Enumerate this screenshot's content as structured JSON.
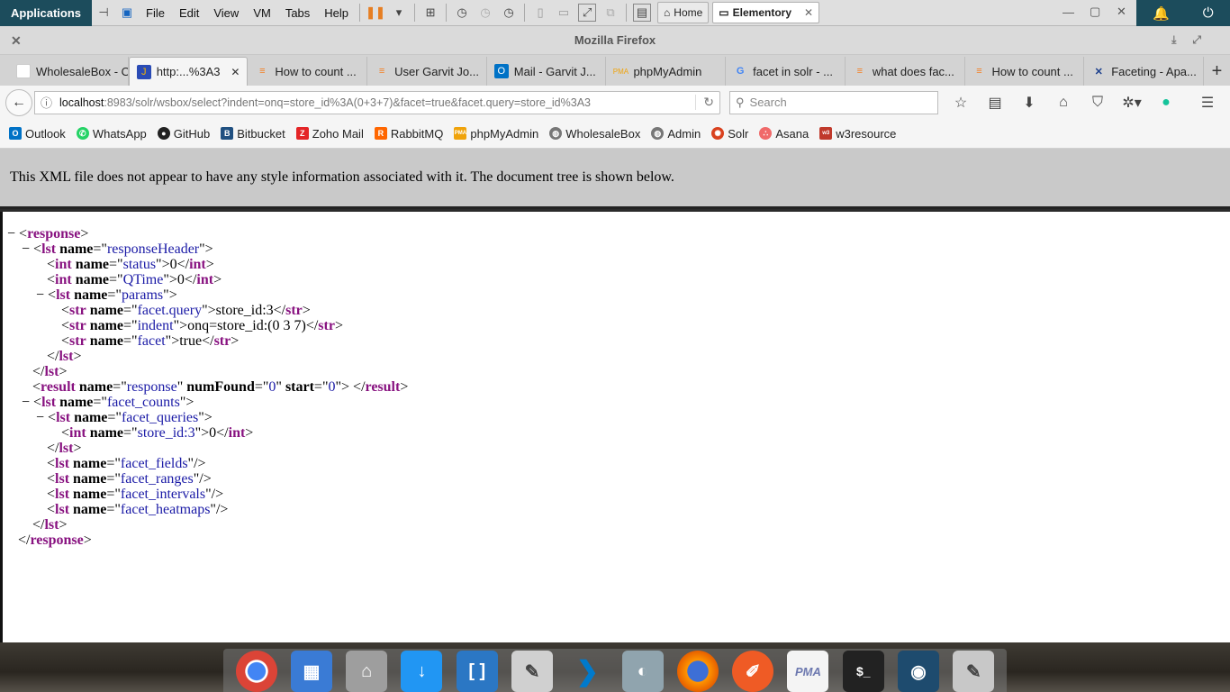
{
  "system_bar": {
    "applications": "Applications",
    "menus": [
      "File",
      "Edit",
      "View",
      "VM",
      "Tabs",
      "Help"
    ],
    "home_tab": "Home",
    "active_tab": "Elementory"
  },
  "window": {
    "title": "Mozilla Firefox"
  },
  "tabs": [
    {
      "label": "WholesaleBox - O...",
      "icon_color": "#ffffff"
    },
    {
      "label": "http:...%3A3",
      "icon_color": "#2a4bb5",
      "selected": true
    },
    {
      "label": "How to count ...",
      "icon_color": "#f48024"
    },
    {
      "label": "User Garvit Jo...",
      "icon_color": "#f48024"
    },
    {
      "label": "Mail - Garvit J...",
      "icon_color": "#0072c6"
    },
    {
      "label": "phpMyAdmin",
      "icon_color": "#f0a30a"
    },
    {
      "label": "facet in solr - ...",
      "icon_color": "#4285f4"
    },
    {
      "label": "what does fac...",
      "icon_color": "#f48024"
    },
    {
      "label": "How to count ...",
      "icon_color": "#f48024"
    },
    {
      "label": "Faceting - Apa...",
      "icon_color": "#1a3e8c"
    }
  ],
  "navbar": {
    "url_host": "localhost",
    "url_rest": ":8983/solr/wsbox/select?indent=onq=store_id%3A(0+3+7)&facet=true&facet.query=store_id%3A3",
    "search_placeholder": "Search"
  },
  "bookmarks": [
    {
      "label": "Outlook",
      "color": "#0072c6",
      "glyph": "O"
    },
    {
      "label": "WhatsApp",
      "color": "#25d366",
      "glyph": "W"
    },
    {
      "label": "GitHub",
      "color": "#222222",
      "glyph": "G"
    },
    {
      "label": "Bitbucket",
      "color": "#205081",
      "glyph": "B"
    },
    {
      "label": "Zoho Mail",
      "color": "#e42527",
      "glyph": "Z"
    },
    {
      "label": "RabbitMQ",
      "color": "#ff6600",
      "glyph": "R"
    },
    {
      "label": "phpMyAdmin",
      "color": "#f0a30a",
      "glyph": "P"
    },
    {
      "label": "WholesaleBox",
      "color": "#777777",
      "glyph": "W"
    },
    {
      "label": "Admin",
      "color": "#777777",
      "glyph": "A"
    },
    {
      "label": "Solr",
      "color": "#d9411e",
      "glyph": "S"
    },
    {
      "label": "Asana",
      "color": "#f06a6a",
      "glyph": "A"
    },
    {
      "label": "w3resource",
      "color": "#c0392b",
      "glyph": "w"
    }
  ],
  "notice": "This XML file does not appear to have any style information associated with it. The document tree is shown below.",
  "xml": {
    "response": "response",
    "lst": "lst",
    "int": "int",
    "str": "str",
    "result": "result",
    "name": "name",
    "numFound": "numFound",
    "start": "start",
    "responseHeader": "responseHeader",
    "status": "status",
    "status_val": "0",
    "qtime": "QTime",
    "qtime_val": "0",
    "params": "params",
    "facet_query": "facet.query",
    "facet_query_val": "store_id:3",
    "indent": "indent",
    "indent_val": "onq=store_id:(0 3 7)",
    "facet": "facet",
    "facet_val": "true",
    "result_name": "response",
    "numFound_val": "0",
    "start_val": "0",
    "facet_counts": "facet_counts",
    "facet_queries": "facet_queries",
    "store_id3": "store_id:3",
    "store_id3_val": "0",
    "facet_fields": "facet_fields",
    "facet_ranges": "facet_ranges",
    "facet_intervals": "facet_intervals",
    "facet_heatmaps": "facet_heatmaps"
  },
  "dock": [
    {
      "name": "chrome",
      "color": "#db4437",
      "glyph": "◉"
    },
    {
      "name": "workspace",
      "color": "#3a7bd5",
      "glyph": "▦"
    },
    {
      "name": "files",
      "color": "#9e9e9e",
      "glyph": "⌂"
    },
    {
      "name": "downloads",
      "color": "#2196f3",
      "glyph": "↓"
    },
    {
      "name": "brackets",
      "color": "#2b77c4",
      "glyph": "[ ]"
    },
    {
      "name": "text-editor",
      "color": "#bdbdbd",
      "glyph": "✎"
    },
    {
      "name": "vscode",
      "color": "#007acc",
      "glyph": "❯"
    },
    {
      "name": "toggle",
      "color": "#90a4ae",
      "glyph": "◐"
    },
    {
      "name": "firefox",
      "color": "#e66000",
      "glyph": "●"
    },
    {
      "name": "postman",
      "color": "#ef5b25",
      "glyph": "✐"
    },
    {
      "name": "phpmyadmin",
      "color": "#f4f4f4",
      "glyph": "PMA"
    },
    {
      "name": "terminal",
      "color": "#222222",
      "glyph": "$_"
    },
    {
      "name": "mysql-workbench",
      "color": "#1e4b6e",
      "glyph": "🐬"
    },
    {
      "name": "notes",
      "color": "#c8c8c8",
      "glyph": "✎"
    }
  ]
}
